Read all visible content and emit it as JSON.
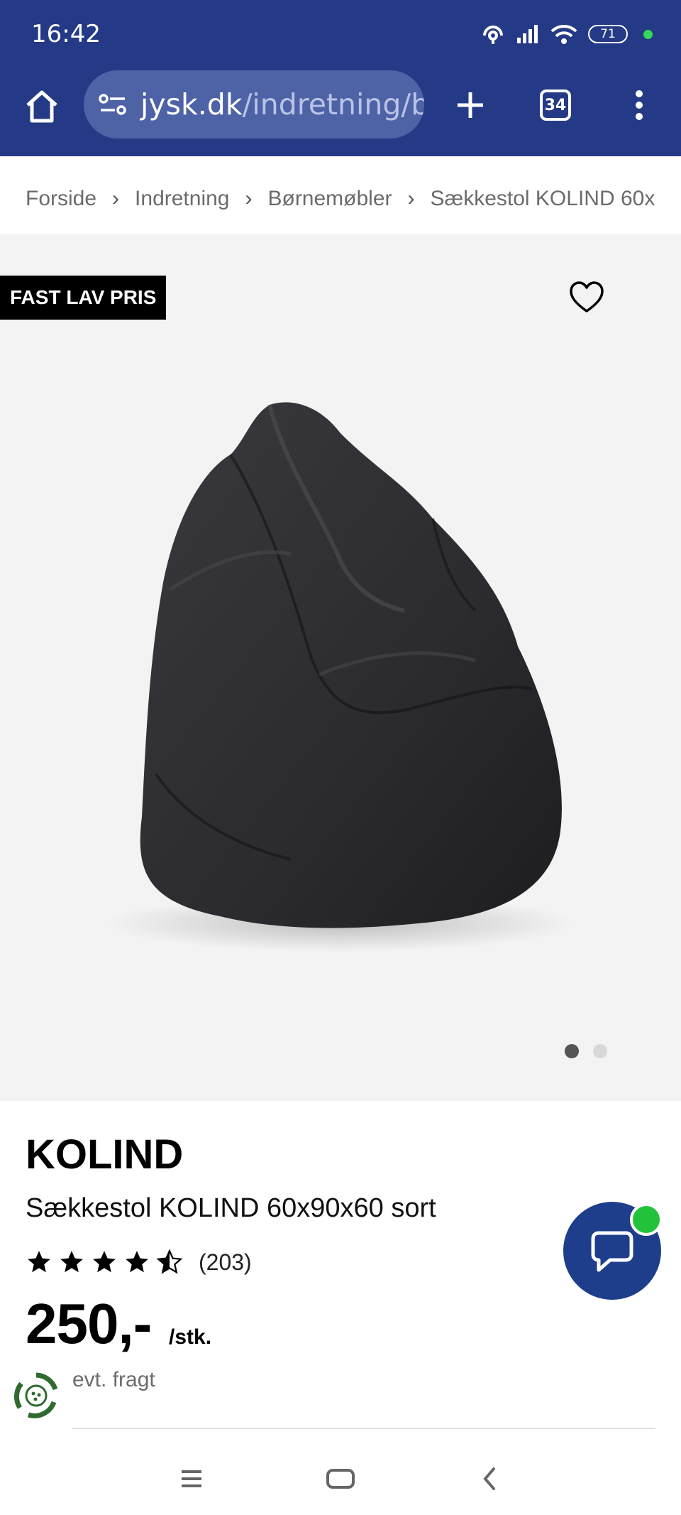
{
  "status_bar": {
    "time": "16:42",
    "battery": "71",
    "icons": [
      "hotspot-icon",
      "signal-icon",
      "wifi-icon",
      "battery-icon"
    ]
  },
  "browser": {
    "url_domain": "jysk.dk",
    "url_path": "/indretning/bor",
    "tab_count": "34",
    "icons": [
      "home-icon",
      "site-settings-icon",
      "plus-icon",
      "more-vert-icon"
    ]
  },
  "breadcrumb": {
    "items": [
      "Forside",
      "Indretning",
      "Børnemøbler",
      "Sækkestol KOLIND 60x"
    ],
    "separator": "›"
  },
  "gallery": {
    "badge": "FAST LAV PRIS",
    "dot_count": 2,
    "active_index": 0
  },
  "product": {
    "brand": "KOLIND",
    "name": "Sækkestol KOLIND 60x90x60 sort",
    "rating_stars": 4.5,
    "rating_count": "(203)",
    "price": "250,-",
    "unit": "/stk.",
    "freight": "evt. fragt"
  },
  "colors": {
    "chrome_bg": "#253a86",
    "chat_button": "#1e3e8c",
    "chat_indicator": "#22c33a",
    "gallery_bg": "#f3f3f3"
  }
}
